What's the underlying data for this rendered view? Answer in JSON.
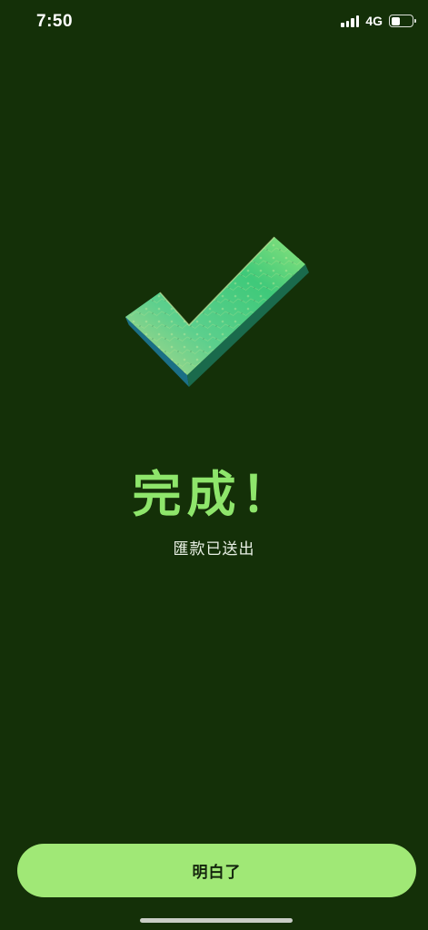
{
  "status_bar": {
    "time": "7:50",
    "network": "4G",
    "battery_level": 0.45
  },
  "result": {
    "title": "完成！",
    "subtitle": "匯款已送出"
  },
  "actions": {
    "confirm_label": "明白了"
  },
  "colors": {
    "background": "#143008",
    "accent": "#8ee56b",
    "button": "#a0e876"
  }
}
